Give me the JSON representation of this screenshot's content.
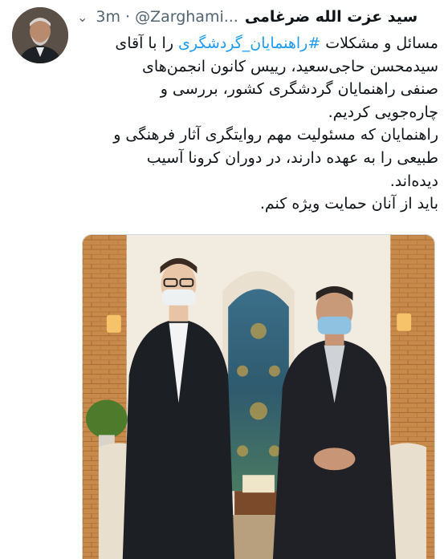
{
  "tweet": {
    "author": {
      "display_name": "سید عزت الله ضرغامی",
      "handle": "@Zarghami...",
      "avatar_icon": "profile-photo"
    },
    "time": "3m",
    "separator": "·",
    "menu_icon": "chevron-down-icon",
    "text": {
      "line1_before": "مسائل و مشکلات",
      "hashtag": "#راهنمایان_گردشگری",
      "line1_after": "را با آقای",
      "line2": "سیدمحسن حاجی‌سعید، رییس کانون انجمن‌های",
      "line3": "صنفی راهنمایان گردشگری کشور، بررسی و",
      "line4": "چاره‌جویی کردیم.",
      "line5": "راهنمایان که مسئولیت مهم روایتگری آثار فرهنگی و",
      "line6": "طبیعی را به عهده دارند، در دوران کرونا آسیب",
      "line7": "دیده‌اند.",
      "line8": "باید از آنان حمایت ویژه کنم."
    },
    "media": {
      "type": "photo"
    }
  },
  "colors": {
    "text": "#0f1419",
    "secondary": "#536471",
    "link": "#1d9bf0",
    "border": "#cfd9de"
  }
}
